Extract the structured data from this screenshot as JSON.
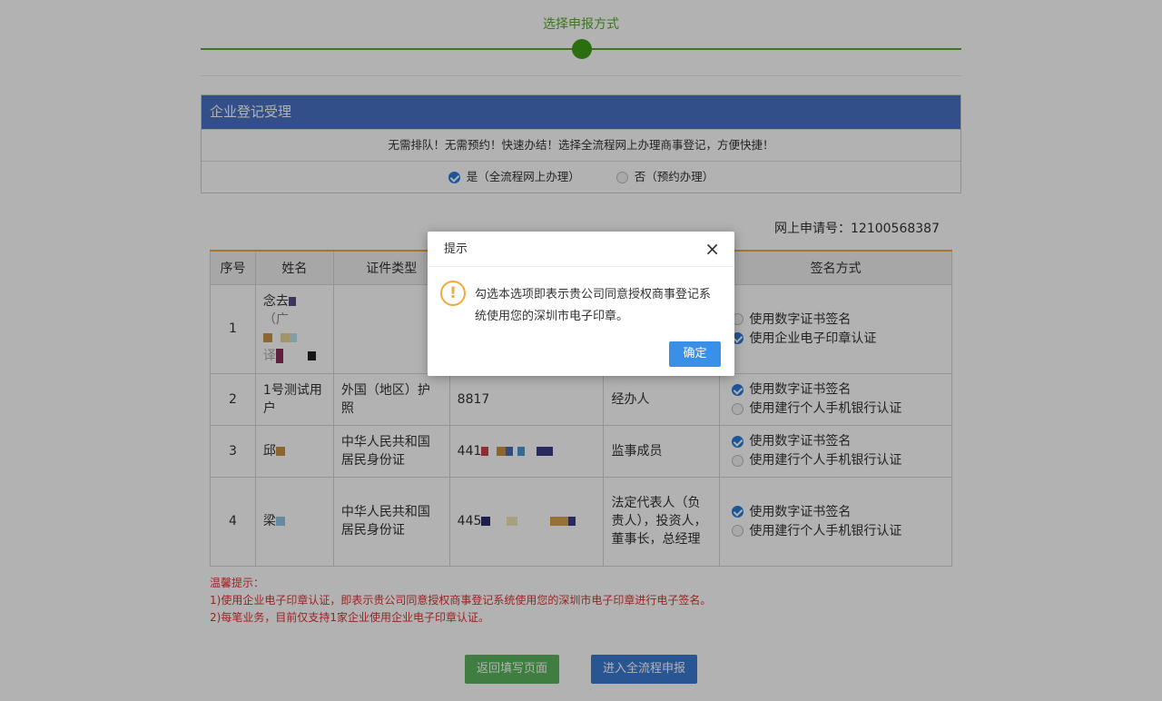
{
  "step": {
    "title": "选择申报方式"
  },
  "panel": {
    "title": "企业登记受理",
    "notice": "无需排队！无需预约！快速办结！选择全流程网上办理商事登记，方便快捷！",
    "option_yes": "是（全流程网上办理）",
    "option_no": "否（预约办理）"
  },
  "app_no": {
    "label": "网上申请号：",
    "value": "12100568387"
  },
  "table": {
    "headers": [
      "序号",
      "姓名",
      "证件类型",
      "",
      "",
      "签名方式"
    ],
    "rows": [
      {
        "no": "1",
        "name_line1": "念去",
        "name_line2": "（广",
        "name_line3": "",
        "name_line4": "译",
        "cert_type": "",
        "cert_no": "",
        "role": "",
        "opt_a": "使用数字证书签名",
        "opt_b": "使用企业电子印章认证"
      },
      {
        "no": "2",
        "name_line1": "1号测试用户",
        "cert_type": "外国（地区）护照",
        "cert_no": "8817",
        "role": "经办人",
        "opt_a": "使用数字证书签名",
        "opt_b": "使用建行个人手机银行认证"
      },
      {
        "no": "3",
        "name_line1": "邱",
        "cert_type": "中华人民共和国居民身份证",
        "cert_no": "441",
        "role": "监事成员",
        "opt_a": "使用数字证书签名",
        "opt_b": "使用建行个人手机银行认证"
      },
      {
        "no": "4",
        "name_line1": "梁",
        "cert_type": "中华人民共和国居民身份证",
        "cert_no": "445",
        "role": "法定代表人（负责人），投资人，董事长，总经理",
        "opt_a": "使用数字证书签名",
        "opt_b": "使用建行个人手机银行认证"
      }
    ]
  },
  "tips": {
    "title": "温馨提示：",
    "line1": "1)使用企业电子印章认证，即表示贵公司同意授权商事登记系统使用您的深圳市电子印章进行电子签名。",
    "line2": "2)每笔业务，目前仅支持1家企业使用企业电子印章认证。"
  },
  "buttons": {
    "back": "返回填写页面",
    "go": "进入全流程申报"
  },
  "dialog": {
    "title": "提示",
    "close": "×",
    "icon": "!",
    "message": "勾选本选项即表示贵公司同意授权商事登记系统使用您的深圳市电子印章。",
    "ok": "确定"
  },
  "colors": {
    "accent_green": "#5aa833",
    "panel_blue": "#4a72c4",
    "warning_orange": "#f0a93a",
    "tip_red": "#d33333"
  }
}
